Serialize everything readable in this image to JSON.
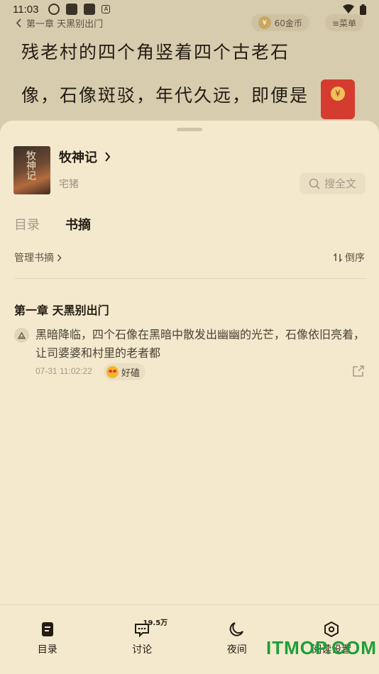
{
  "status_bar": {
    "time": "11:03",
    "small_badge": "A"
  },
  "reader": {
    "back_label": "第一章 天黑别出门",
    "coins_label": "60金币",
    "coin_symbol": "¥",
    "menu_label": "≡菜单",
    "line1": "残老村的四个角竖着四个古老石",
    "line2": "像，石像斑驳，年代久远，即便是"
  },
  "book": {
    "title": "牧神记",
    "author": "宅猪",
    "cover_text": "牧神记",
    "search_label": "搜全文"
  },
  "tabs": [
    {
      "label": "目录",
      "active": false
    },
    {
      "label": "书摘",
      "active": true
    }
  ],
  "toolbar": {
    "manage_label": "管理书摘",
    "sort_label": "倒序"
  },
  "notes": [
    {
      "chapter": "第一章 天黑别出门",
      "text": "黑暗降临，四个石像在黑暗中散发出幽幽的光芒，石像依旧亮着，让司婆婆和村里的老者都",
      "time": "07-31 11:02:22",
      "reaction": "好磕"
    }
  ],
  "bottom_nav": [
    {
      "label": "目录",
      "icon": "toc-icon"
    },
    {
      "label": "讨论",
      "icon": "discussion-icon",
      "badge": "19.5万"
    },
    {
      "label": "夜间",
      "icon": "moon-icon"
    },
    {
      "label": "阅读设置",
      "icon": "settings-icon"
    }
  ],
  "watermark": "ITMOP.COM"
}
